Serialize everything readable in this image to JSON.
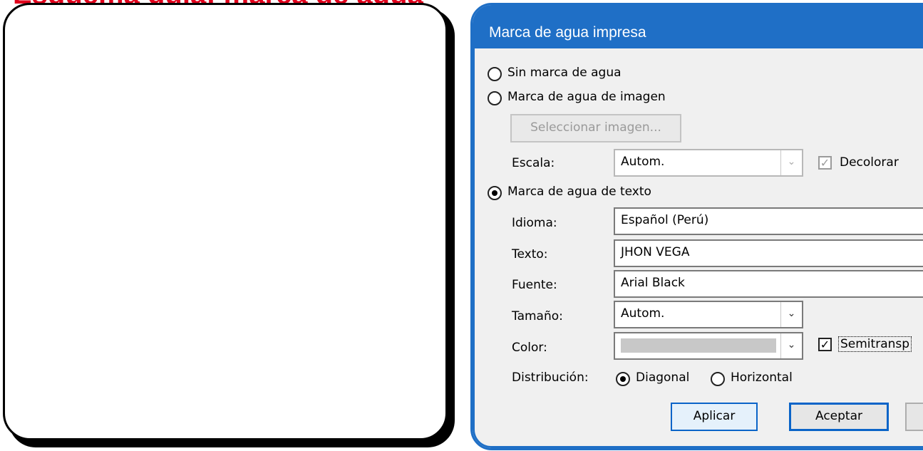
{
  "red_heading": "Esquema guía: marca de agua",
  "dialog": {
    "title": "Marca de agua impresa",
    "options": {
      "none_label": "Sin marca de agua",
      "image_label": "Marca de agua de imagen",
      "text_label": "Marca de agua de texto",
      "selected": "text"
    },
    "image": {
      "select_button": "Seleccionar imagen...",
      "scale_label": "Escala:",
      "scale_value": "Autom.",
      "washout_label": "Decolorar",
      "washout_checked": true
    },
    "text": {
      "language_label": "Idioma:",
      "language_value": "Español (Perú)",
      "text_label": "Texto:",
      "text_value": "JHON VEGA",
      "font_label": "Fuente:",
      "font_value": "Arial Black",
      "size_label": "Tamaño:",
      "size_value": "Autom.",
      "color_label": "Color:",
      "color_value": "#c8c8c8",
      "semitransparent_label": "Semitransp",
      "semitransparent_checked": true,
      "layout_label": "Distribución:",
      "diagonal_label": "Diagonal",
      "horizontal_label": "Horizontal",
      "layout_selected": "diagonal"
    },
    "buttons": {
      "apply": "Aplicar",
      "ok": "Aceptar"
    },
    "accent_color": "#1f6fc6"
  }
}
